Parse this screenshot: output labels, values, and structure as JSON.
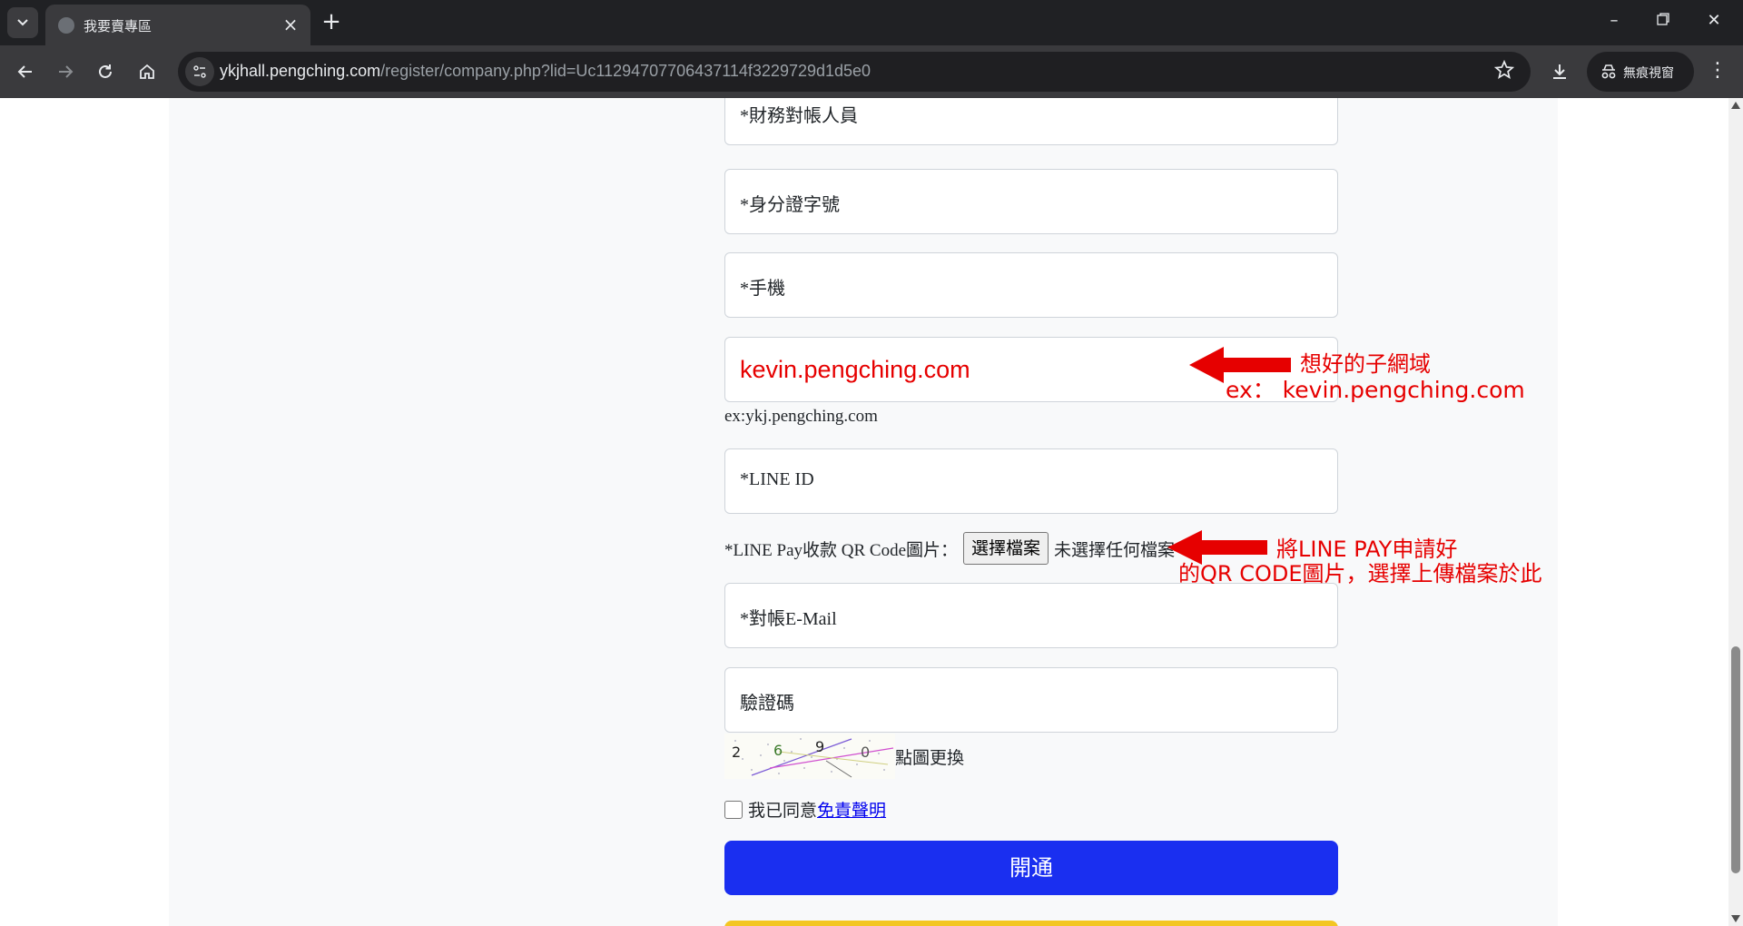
{
  "browser": {
    "tab_title": "我要賣專區",
    "url_host": "ykjhall.pengching.com",
    "url_path": "/register/company.php?lid=Uc11294707706437114f3229729d1d5e0",
    "incognito_label": "無痕視窗"
  },
  "form": {
    "fields": {
      "finance_contact": "*財務對帳人員",
      "id_number": "*身分證字號",
      "mobile": "*手機",
      "subdomain_value": "kevin.pengching.com",
      "line_id": "*LINE ID",
      "email": "*對帳E-Mail",
      "captcha": "驗證碼"
    },
    "subdomain_hint": "ex:ykj.pengching.com",
    "qr_label": "*LINE Pay收款 QR Code圖片：",
    "file_button": "選擇檔案",
    "file_status": "未選擇任何檔案",
    "captcha_refresh": "點圖更換",
    "captcha_digits": [
      "2",
      "6",
      "9",
      "0"
    ],
    "agree_text": "我已同意",
    "agree_link": "免責聲明",
    "submit": "開通"
  },
  "annotations": {
    "subdomain_line1": "想好的子網域",
    "subdomain_line2": "ex： kevin.pengching.com",
    "qr_line1": "將LINE PAY申請好",
    "qr_line2": "的QR CODE圖片，選擇上傳檔案於此"
  },
  "colors": {
    "annotation_red": "#e60000",
    "submit_blue": "#1a2ff0",
    "chrome_dark": "#202124"
  }
}
